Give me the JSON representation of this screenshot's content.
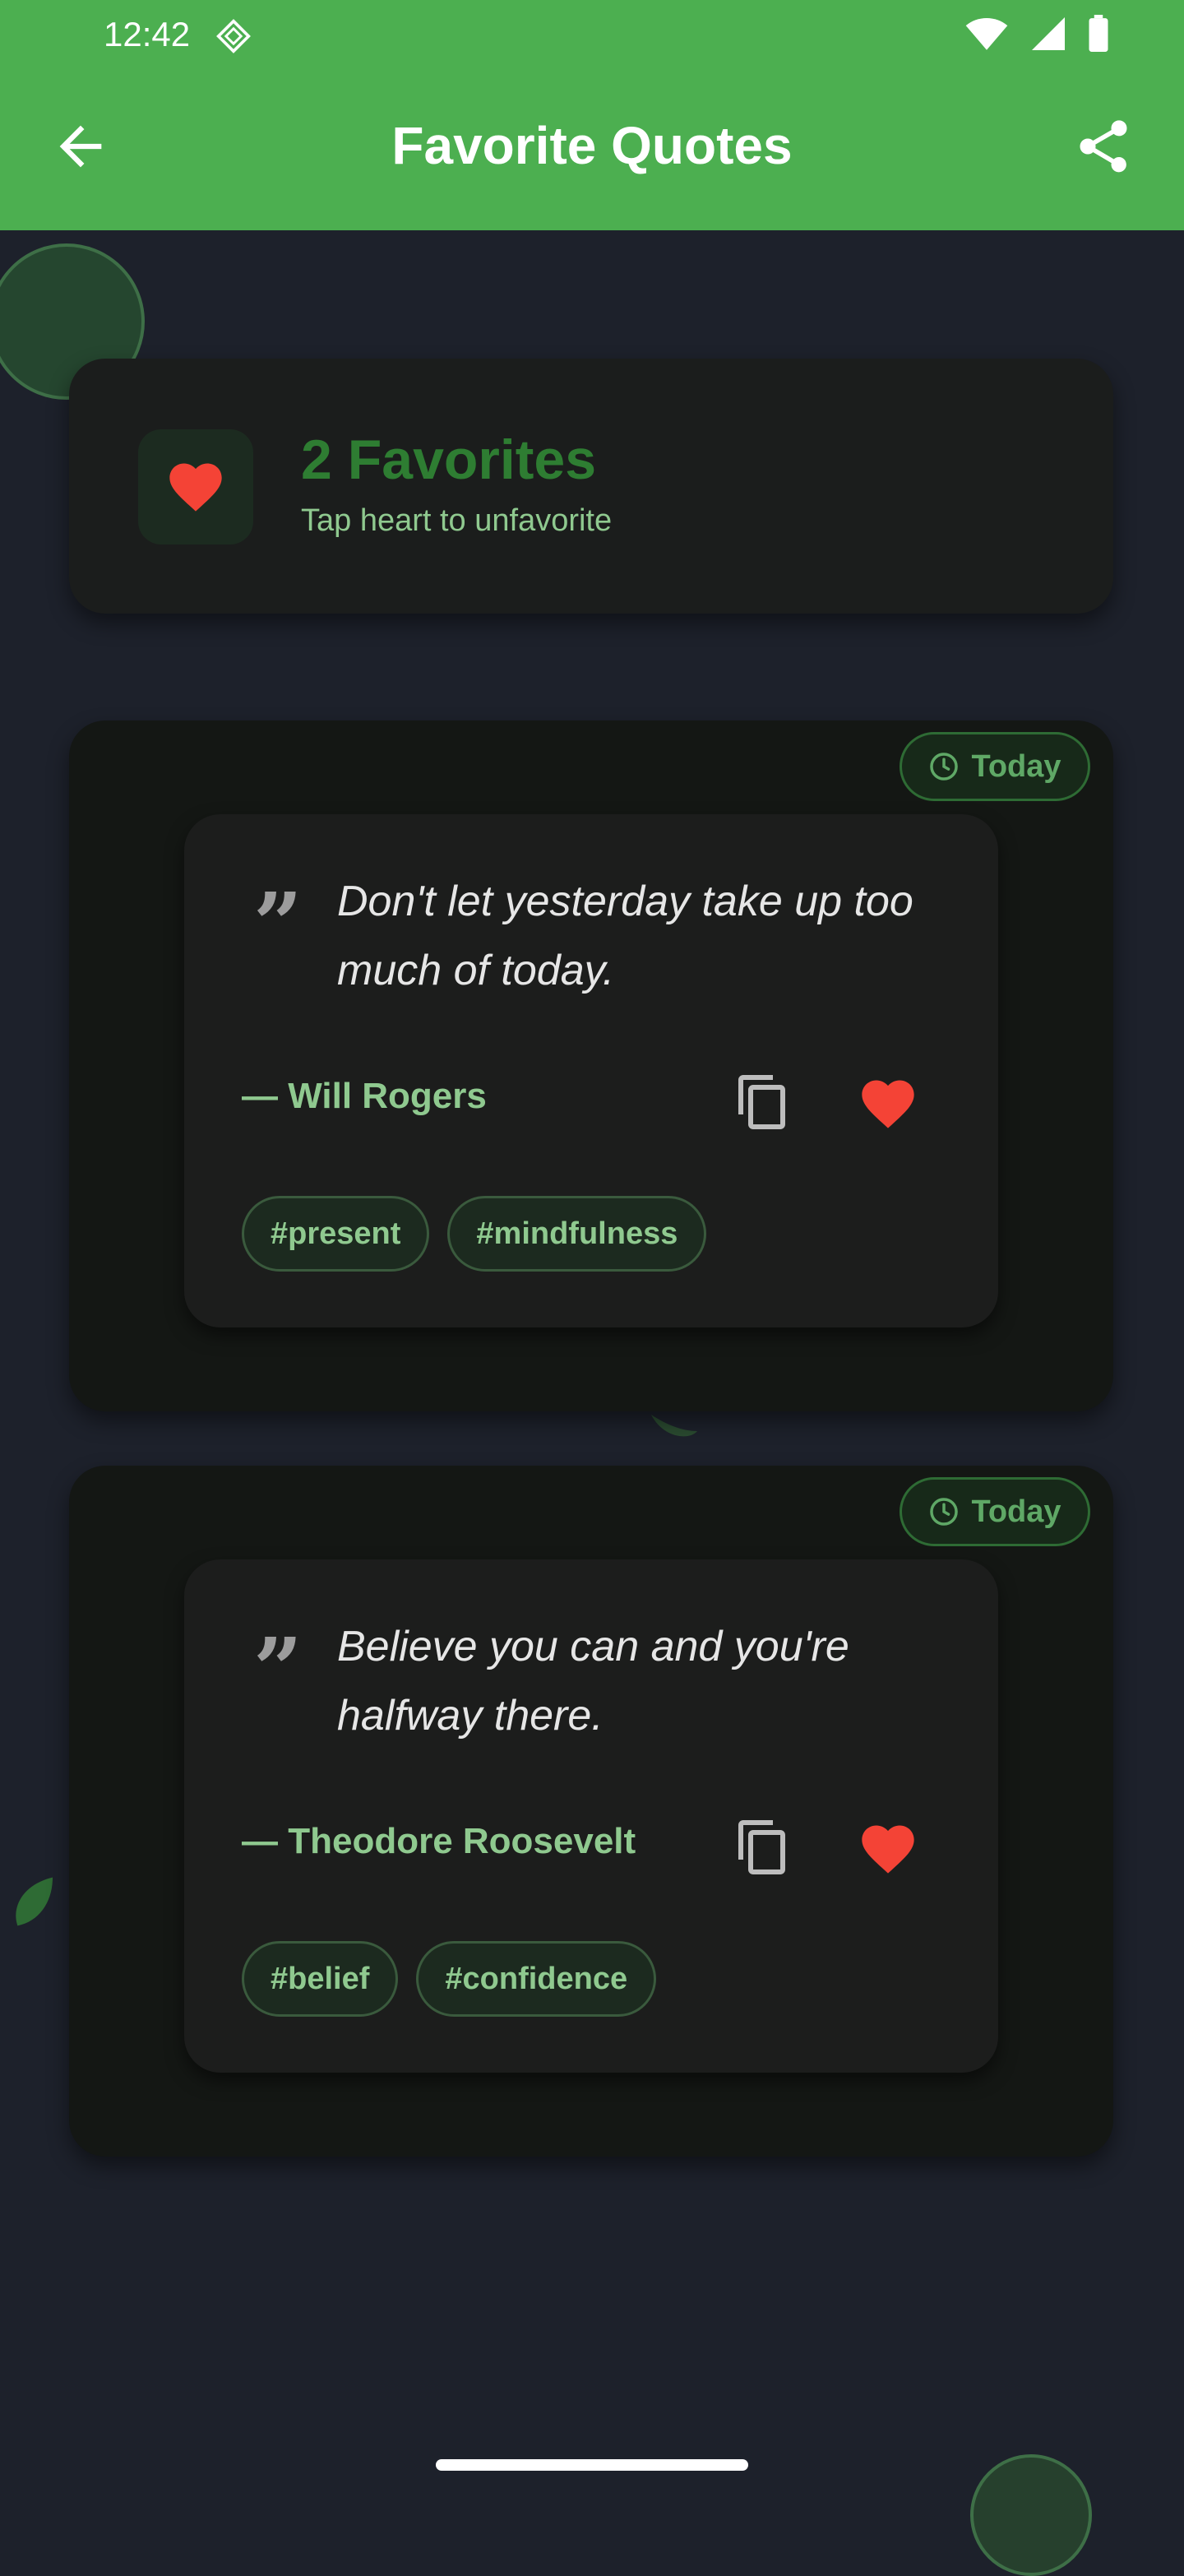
{
  "status_bar": {
    "time": "12:42"
  },
  "app_bar": {
    "title": "Favorite Quotes"
  },
  "summary": {
    "count_label": "2 Favorites",
    "hint": "Tap heart to unfavorite"
  },
  "quotes": [
    {
      "chip": "Today",
      "text": "Don't let yesterday take up too much of today.",
      "author": "— Will Rogers",
      "tags": [
        "#present",
        "#mindfulness"
      ]
    },
    {
      "chip": "Today",
      "text": "Believe you can and you're halfway there.",
      "author": "— Theodore Roosevelt",
      "tags": [
        "#belief",
        "#confidence"
      ]
    }
  ],
  "colors": {
    "app_bar": "#4caf50",
    "background": "#1d212b",
    "accent_green": "#8fc98f",
    "heart_red": "#f44336"
  },
  "icons": {
    "back": "arrow-back-icon",
    "share": "share-icon",
    "copy": "copy-icon",
    "favorite": "heart-icon",
    "chip": "clock-icon",
    "quote": "format-quote-icon"
  }
}
